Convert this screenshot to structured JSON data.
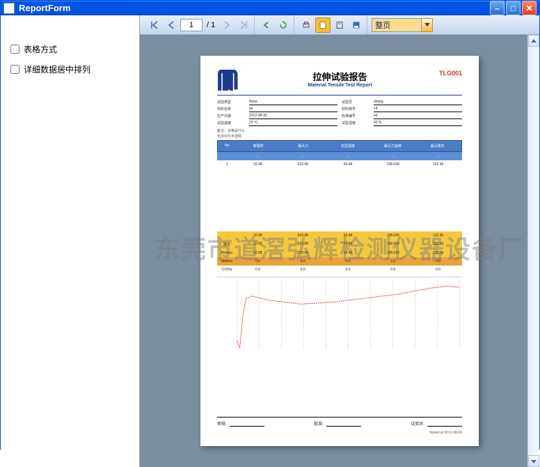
{
  "window": {
    "title": "ReportForm"
  },
  "sidebar": {
    "check_table_mode": "表格方式",
    "check_center_align": "详细数据居中排列"
  },
  "toolbar": {
    "page_current": "1",
    "page_total": "/ 1",
    "zoom_value": "整页"
  },
  "report": {
    "title_cn": "拉伸试验报告",
    "title_en": "Material Tensile Test Report",
    "code": "TLG001",
    "meta": {
      "l1": "试验类型",
      "v1": "None",
      "l2": "试验员",
      "v2": "zhang",
      "l3": "材料名称",
      "v3": "as",
      "l4": "材料牌号",
      "v4": "14",
      "l5": "生产日期",
      "v5": "2012-08-30",
      "l6": "标准编号",
      "v6": "ok",
      "l7": "试验温度",
      "v7": "23",
      "l8": "试验湿度",
      "v8": "60"
    },
    "unit_c": "℃",
    "unit_rh": "%",
    "note1": "备注：合格是什么",
    "note2": "色泽均匀半透明",
    "columns": {
      "c0": "No.",
      "c1": "断裂时",
      "c2": "最大力",
      "c3": "抗拉强度",
      "c4": "最大力延伸",
      "c5": "最大变形"
    },
    "rows": [
      {
        "c0": "1",
        "c1": "32.08",
        "c2": "623.98",
        "c3": "92.48",
        "c4": "138.039",
        "c5": "132.36"
      }
    ],
    "summary": [
      {
        "label": "...",
        "c1": "32.08",
        "c2": "623.98",
        "c3": "92.48",
        "c4": "138.039",
        "c5": "132.36"
      },
      {
        "label": "最大",
        "c1": "32.08",
        "c2": "623.98",
        "c3": "92.48",
        "c4": "138.039",
        "c5": "132.36"
      },
      {
        "label": "Median",
        "c1": "32.08",
        "c2": "623.98",
        "c3": "92.48",
        "c4": "138.039",
        "c5": "132.36"
      },
      {
        "label": "StdDev",
        "c1": "0.0",
        "c2": "0.0",
        "c3": "0.0",
        "c4": "0.0",
        "c5": "0.0"
      },
      {
        "label": "CV(%)",
        "c1": "0.0",
        "c2": "0.0",
        "c3": "0.0",
        "c4": "0.0",
        "c5": "0.0"
      }
    ],
    "foot": {
      "l1": "审核:",
      "l2": "批准:",
      "l3": "试验员:"
    },
    "footdate": "Tested at 2012-08-30"
  },
  "watermark": "东莞市道滘弘辉检测仪器设备厂",
  "chart_data": {
    "type": "line",
    "title": "",
    "xlabel": "",
    "ylabel": "",
    "x": [
      0,
      2,
      4,
      6,
      10,
      20,
      40,
      60,
      80,
      100,
      120,
      130,
      138
    ],
    "series": [
      {
        "name": "1",
        "values": [
          0,
          -80,
          260,
          420,
          440,
          400,
          360,
          380,
          420,
          460,
          520,
          540,
          530
        ]
      }
    ],
    "ylim": [
      -100,
      600
    ]
  }
}
